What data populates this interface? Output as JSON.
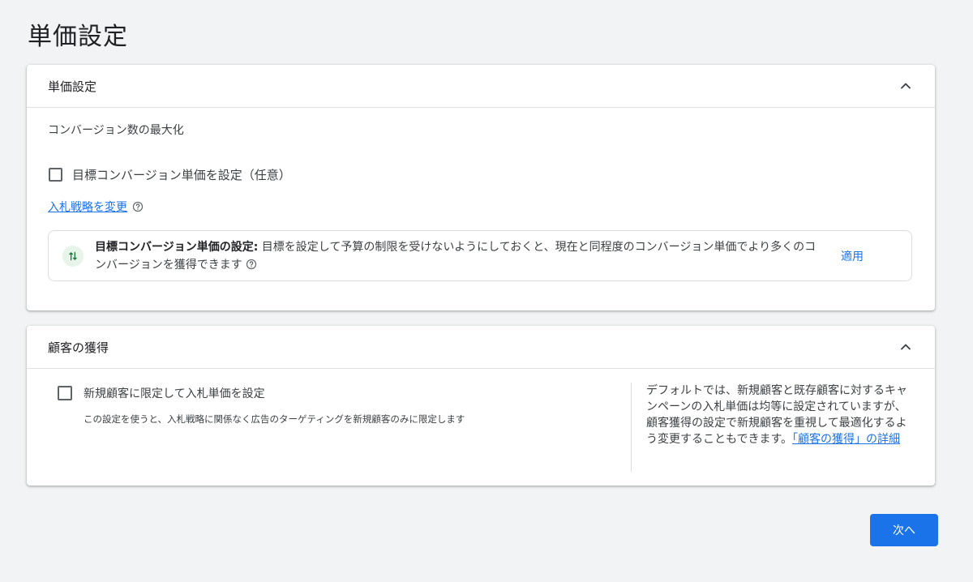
{
  "page": {
    "title": "単価設定"
  },
  "bidding": {
    "header": "単価設定",
    "strategy": "コンバージョン数の最大化",
    "target_cpa_checkbox_label": "目標コンバージョン単価を設定（任意）",
    "change_strategy_link": "入札戦略を変更",
    "recommendation": {
      "bold": "目標コンバージョン単価の設定:",
      "text": " 目標を設定して予算の制限を受けないようにしておくと、現在と同程度のコンバージョン単価でより多くのコンバージョンを獲得できます",
      "apply": "適用"
    }
  },
  "customer_acquisition": {
    "header": "顧客の獲得",
    "checkbox_label": "新規顧客に限定して入札単価を設定",
    "description": "この設定を使うと、入札戦略に関係なく広告のターゲティングを新規顧客のみに限定します",
    "side_text": "デフォルトでは、新規顧客と既存顧客に対するキャンペーンの入札単価は均等に設定されていますが、顧客獲得の設定で新規顧客を重視して最適化するよう変更することもできます。",
    "details_link": "「顧客の獲得」の詳細"
  },
  "footer": {
    "next_button": "次へ"
  },
  "colors": {
    "primary": "#1a73e8",
    "reco_icon_bg": "#e6f4ea",
    "reco_icon_fg": "#137333"
  },
  "icons": {
    "collapse": "chevron-up-icon",
    "help": "help-circle-icon",
    "recommendation": "swap-arrows-icon"
  }
}
